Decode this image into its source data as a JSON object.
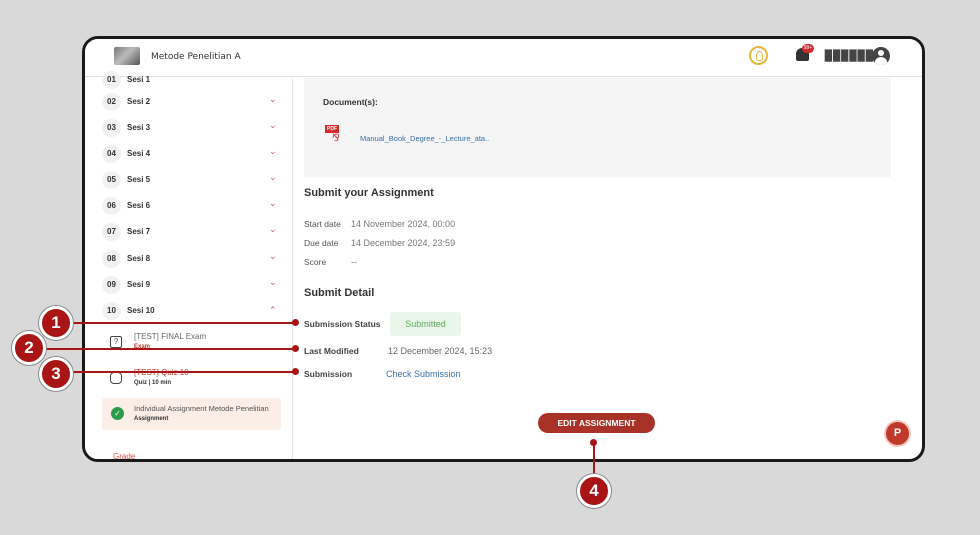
{
  "header": {
    "course_title": "Metode Penelitian A",
    "notification_count": "99+",
    "username": "▉▉▉▉▉▉"
  },
  "sidebar": {
    "sessions": [
      {
        "num": "01",
        "label": "Sesi 1"
      },
      {
        "num": "02",
        "label": "Sesi 2"
      },
      {
        "num": "03",
        "label": "Sesi 3"
      },
      {
        "num": "04",
        "label": "Sesi 4"
      },
      {
        "num": "05",
        "label": "Sesi 5"
      },
      {
        "num": "06",
        "label": "Sesi 6"
      },
      {
        "num": "07",
        "label": "Sesi 7"
      },
      {
        "num": "08",
        "label": "Sesi 8"
      },
      {
        "num": "09",
        "label": "Sesi 9"
      },
      {
        "num": "10",
        "label": "Sesi 10"
      }
    ],
    "items": [
      {
        "title": "[TEST] FINAL Exam",
        "type": "Exam"
      },
      {
        "title": "[TEST] Quiz 10",
        "type": "Quiz | 10 min"
      },
      {
        "title": "Individual Assignment Metode Penelitian",
        "type": "Assignment"
      }
    ],
    "grade_label": "Grade"
  },
  "document": {
    "heading": "Document(s):",
    "pdf_tag": "PDF",
    "file_name": "Manual_Book_Degree_-_Lecture_ata.."
  },
  "submit": {
    "heading": "Submit your Assignment",
    "start_label": "Start date",
    "start_value": "14 November 2024, 00:00",
    "due_label": "Due date",
    "due_value": "14 December 2024, 23:59",
    "score_label": "Score",
    "score_value": "--"
  },
  "detail": {
    "heading": "Submit Detail",
    "status_label": "Submission Status",
    "status_value": "Submitted",
    "modified_label": "Last Modified",
    "modified_value": "12 December 2024, 15:23",
    "submission_label": "Submission",
    "submission_link": "Check Submission"
  },
  "actions": {
    "edit_label": "EDIT ASSIGNMENT",
    "chat_label": "P"
  },
  "markers": [
    "1",
    "2",
    "3",
    "4"
  ],
  "colors": {
    "accent": "#a93228",
    "marker": "#a91414",
    "link": "#3b6fb0",
    "status_green": "#5cab5c"
  }
}
